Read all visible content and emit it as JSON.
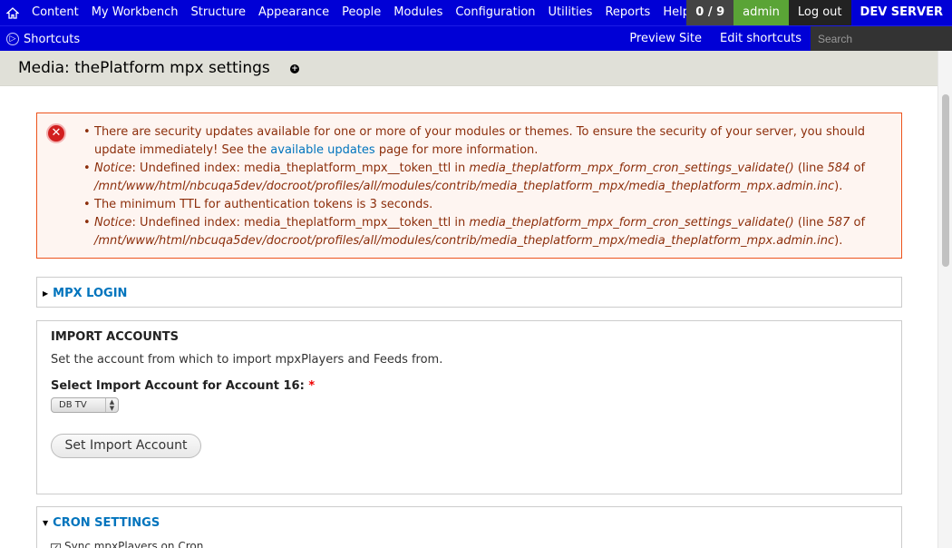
{
  "toolbar": {
    "menu": [
      "Content",
      "My Workbench",
      "Structure",
      "Appearance",
      "People",
      "Modules",
      "Configuration",
      "Utilities",
      "Reports",
      "Help"
    ],
    "count": "0 / 9",
    "user": "admin",
    "logout": "Log out",
    "server": "DEV SERVER"
  },
  "shortcuts": {
    "toggle_label": "Shortcuts",
    "preview_site": "Preview Site",
    "edit_shortcuts": "Edit shortcuts",
    "search_placeholder": "Search"
  },
  "page": {
    "title": "Media: thePlatform mpx settings"
  },
  "messages": {
    "security_part1": "There are security updates available for one or more of your modules or themes. To ensure the security of your server, you should update immediately! See the ",
    "security_link": "available updates",
    "security_part2": " page for more information.",
    "notice1_label": "Notice",
    "notice1_text": ": Undefined index: media_theplatform_mpx__token_ttl in ",
    "notice1_fn": "media_theplatform_mpx_form_cron_settings_validate()",
    "notice1_line_pre": " (line ",
    "notice1_line": "584",
    "notice1_of": " of ",
    "notice1_path": "/mnt/www/html/nbcuqa5dev/docroot/profiles/all/modules/contrib/media_theplatform_mpx/media_theplatform_mpx.admin.inc",
    "notice1_end": ").",
    "ttl_message": "The minimum TTL for authentication tokens is 3 seconds.",
    "notice2_label": "Notice",
    "notice2_text": ": Undefined index: media_theplatform_mpx__token_ttl in ",
    "notice2_fn": "media_theplatform_mpx_form_cron_settings_validate()",
    "notice2_line_pre": " (line ",
    "notice2_line": "587",
    "notice2_of": " of ",
    "notice2_path": "/mnt/www/html/nbcuqa5dev/docroot/profiles/all/modules/contrib/media_theplatform_mpx/media_theplatform_mpx.admin.inc",
    "notice2_end": ")."
  },
  "mpx_login": {
    "legend": "MPX LOGIN"
  },
  "import_accounts": {
    "title": "IMPORT ACCOUNTS",
    "description": "Set the account from which to import mpxPlayers and Feeds from.",
    "select_label": "Select Import Account for Account 16: ",
    "required_marker": "*",
    "selected_value": "DB TV",
    "button_label": "Set Import Account"
  },
  "cron_settings": {
    "legend": "CRON SETTINGS",
    "sync_label": "Sync mpxPlayers on Cron"
  }
}
